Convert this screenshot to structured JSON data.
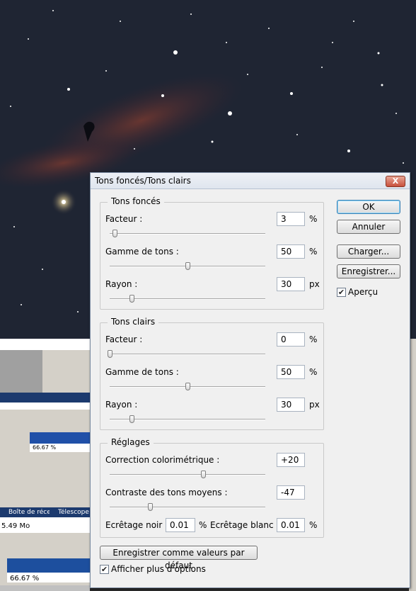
{
  "dialog": {
    "title": "Tons foncés/Tons clairs",
    "close_glyph": "X",
    "shadows": {
      "legend": "Tons foncés",
      "amount": {
        "label": "Facteur :",
        "value": "3",
        "unit": "%",
        "slider": 0.03
      },
      "tonal": {
        "label": "Gamme de tons :",
        "value": "50",
        "unit": "%",
        "slider": 0.5
      },
      "radius": {
        "label": "Rayon :",
        "value": "30",
        "unit": "px",
        "slider": 0.14
      }
    },
    "highlights": {
      "legend": "Tons clairs",
      "amount": {
        "label": "Facteur :",
        "value": "0",
        "unit": "%",
        "slider": 0.0
      },
      "tonal": {
        "label": "Gamme de tons :",
        "value": "50",
        "unit": "%",
        "slider": 0.5
      },
      "radius": {
        "label": "Rayon :",
        "value": "30",
        "unit": "px",
        "slider": 0.14
      }
    },
    "adjustments": {
      "legend": "Réglages",
      "color": {
        "label": "Correction colorimétrique :",
        "value": "+20",
        "slider": 0.6
      },
      "midtone": {
        "label": "Contraste des tons moyens :",
        "value": "-47",
        "slider": 0.26
      },
      "black_clip": {
        "label": "Ecrêtage noir :",
        "value": "0.01",
        "unit": "%"
      },
      "white_clip": {
        "label": "Ecrêtage blanc :",
        "value": "0.01",
        "unit": "%"
      }
    },
    "buttons": {
      "ok": "OK",
      "cancel": "Annuler",
      "load": "Charger...",
      "save": "Enregistrer...",
      "save_defaults": "Enregistrer comme valeurs par défaut"
    },
    "preview": {
      "label": "Aperçu",
      "checked": true
    },
    "more_options": {
      "label": "Afficher plus d'options",
      "checked": true
    }
  },
  "background": {
    "status_a": "5.49 Mo",
    "zoom_a": "66.67 %",
    "zoom_b": "66.67 %",
    "tab_a": "Boîte de réce...",
    "tab_b": "Télescope"
  },
  "colors": {
    "sky": "#1d2230",
    "nebula": "#6a2f2a",
    "dialog_bg": "#f0f0f0",
    "accent": "#3c7fb1"
  }
}
